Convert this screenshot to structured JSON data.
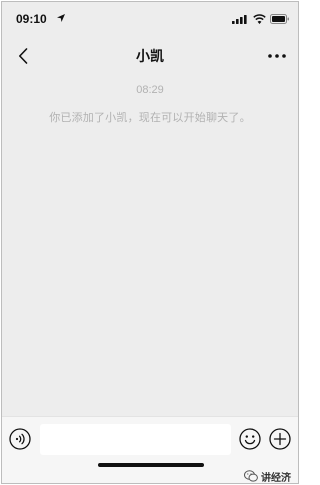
{
  "status_bar": {
    "time": "09:10",
    "icons": [
      "location-arrow-icon",
      "signal-icon",
      "wifi-icon",
      "battery-icon"
    ]
  },
  "nav": {
    "title": "小凯",
    "back_icon": "chevron-left-icon",
    "more_icon": "more-dots-icon"
  },
  "messages": {
    "timestamp": "08:29",
    "system_text": "你已添加了小凯，现在可以开始聊天了。"
  },
  "input_bar": {
    "placeholder": "",
    "value": "",
    "icons": [
      "voice-icon",
      "emoji-icon",
      "plus-icon"
    ]
  },
  "watermark": {
    "text": "讲经济"
  },
  "colors": {
    "background": "#ededed",
    "input_bar": "#f6f6f6",
    "muted_text": "#b2b2b2",
    "primary_text": "#111111"
  }
}
